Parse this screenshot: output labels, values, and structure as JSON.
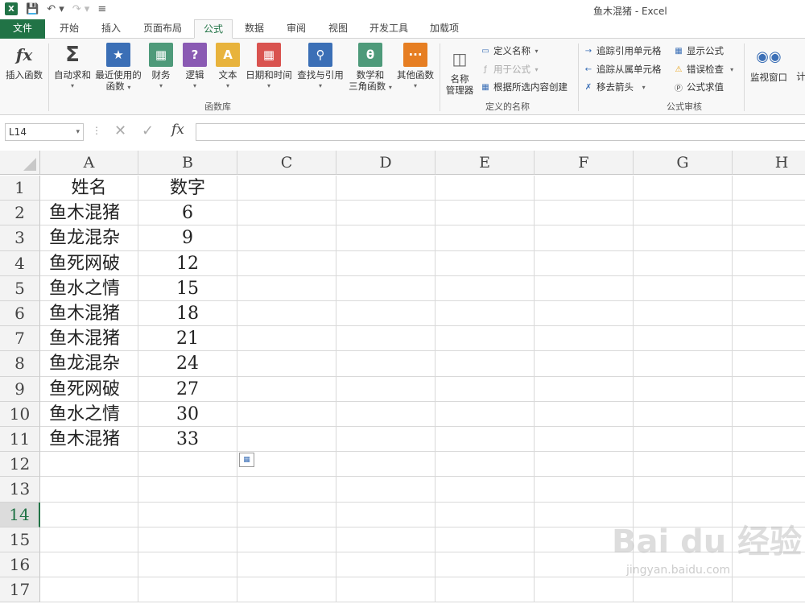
{
  "window": {
    "title": "鱼木混猪 - Excel",
    "logo": "X"
  },
  "quick_access": {
    "save_icon": "save-icon",
    "undo_icon": "undo-icon",
    "redo_icon": "redo-icon"
  },
  "tabs": [
    {
      "label": "文件"
    },
    {
      "label": "开始"
    },
    {
      "label": "插入"
    },
    {
      "label": "页面布局"
    },
    {
      "label": "公式"
    },
    {
      "label": "数据"
    },
    {
      "label": "审阅"
    },
    {
      "label": "视图"
    },
    {
      "label": "开发工具"
    },
    {
      "label": "加载项"
    }
  ],
  "ribbon": {
    "insert_function": "插入函数",
    "autosum": "自动求和",
    "recent_1": "最近使用的",
    "recent_2": "函数",
    "financial": "财务",
    "logical": "逻辑",
    "text": "文本",
    "datetime": "日期和时间",
    "lookup": "查找与引用",
    "math_1": "数学和",
    "math_2": "三角函数",
    "more": "其他函数",
    "group_library": "函数库",
    "name_manager_1": "名称",
    "name_manager_2": "管理器",
    "define_name": "定义名称",
    "use_in_formula": "用于公式",
    "create_from_selection": "根据所选内容创建",
    "group_names": "定义的名称",
    "trace_precedents": "追踪引用单元格",
    "trace_dependents": "追踪从属单元格",
    "remove_arrows": "移去箭头",
    "show_formulas": "显示公式",
    "error_checking": "错误检查",
    "evaluate_formula": "公式求值",
    "group_auditing": "公式审核",
    "watch_window": "监视窗口",
    "calc_partial": "计"
  },
  "formula_bar": {
    "name_box": "L14",
    "formula": "",
    "fx_label": "fx"
  },
  "columns": [
    "A",
    "B",
    "C",
    "D",
    "E",
    "F",
    "G",
    "H"
  ],
  "rows": [
    "1",
    "2",
    "3",
    "4",
    "5",
    "6",
    "7",
    "8",
    "9",
    "10",
    "11",
    "12",
    "13",
    "14",
    "15",
    "16",
    "17"
  ],
  "selected_row": "14",
  "sheet": {
    "col_a": [
      "姓名",
      "鱼木混猪",
      "鱼龙混杂",
      "鱼死网破",
      "鱼水之情",
      "鱼木混猪",
      "鱼木混猪",
      "鱼龙混杂",
      "鱼死网破",
      "鱼水之情",
      "鱼木混猪"
    ],
    "col_b": [
      "数字",
      "6",
      "9",
      "12",
      "15",
      "18",
      "21",
      "24",
      "27",
      "30",
      "33"
    ]
  },
  "watermark": {
    "main": "Bai du 经验",
    "sub": "jingyan.baidu.com"
  },
  "colors": {
    "excel_green": "#217346",
    "accent_blue": "#3b6fb6"
  }
}
